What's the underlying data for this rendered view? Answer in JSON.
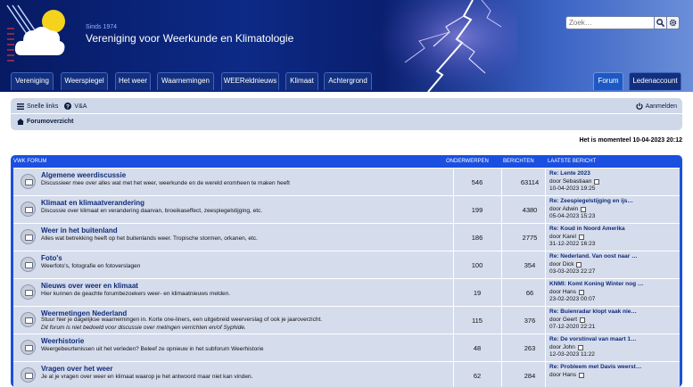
{
  "header": {
    "since": "Sinds 1974",
    "title": "Vereniging voor Weerkunde en Klimatologie",
    "search_placeholder": "Zoek…"
  },
  "tabs": [
    {
      "label": "Vereniging"
    },
    {
      "label": "Weerspiegel"
    },
    {
      "label": "Het weer"
    },
    {
      "label": "Waarnemingen"
    },
    {
      "label": "WEEReldnieuws"
    },
    {
      "label": "Klimaat"
    },
    {
      "label": "Achtergrond"
    },
    {
      "label": "Forum"
    },
    {
      "label": "Ledenaccount"
    }
  ],
  "nav": {
    "quick_links": "Snelle links",
    "faq": "V&A",
    "login": "Aanmelden",
    "forum_index": "Forumoverzicht"
  },
  "current_time": "Het is momenteel 10-04-2023 20:12",
  "forum": {
    "section_title": "VWK FORUM",
    "col_topics": "ONDERWERPEN",
    "col_posts": "BERICHTEN",
    "col_last": "LAATSTE BERICHT",
    "rows": [
      {
        "title": "Algemene weerdiscussie",
        "desc": "Discussieer mee over alles wat met het weer, weerkunde en de wereld eromheen te maken heeft",
        "desc2": "",
        "topics": "546",
        "posts": "63114",
        "last_title": "Re: Lente 2023",
        "last_by": "door Sebastiaan",
        "last_date": "10-04-2023 19:25"
      },
      {
        "title": "Klimaat en klimaatverandering",
        "desc": "Discussie over klimaat en verandering daarvan, broeikaseffect, zeespiegelstijging, etc.",
        "desc2": "",
        "topics": "199",
        "posts": "4380",
        "last_title": "Re: Zeespiegelstijging en ijs…",
        "last_by": "door Adwin",
        "last_date": "05-04-2023 15:23"
      },
      {
        "title": "Weer in het buitenland",
        "desc": "Alles wat betrekking heeft op het buitenlands weer. Tropische stormen, orkanen, etc.",
        "desc2": "",
        "topics": "186",
        "posts": "2775",
        "last_title": "Re: Koud in Noord Amerika",
        "last_by": "door Karel",
        "last_date": "31-12-2022 16:23"
      },
      {
        "title": "Foto's",
        "desc": "Weerfoto's, fotografie en fotoverslagen",
        "desc2": "",
        "topics": "100",
        "posts": "354",
        "last_title": "Re: Nederland. Van oost naar …",
        "last_by": "door Dick",
        "last_date": "03-03-2023 22:27"
      },
      {
        "title": "Nieuws over weer en klimaat",
        "desc": "Hier kunnen de geachte forumbezoekers weer- en klimaatnieuws melden.",
        "desc2": "",
        "topics": "19",
        "posts": "66",
        "last_title": "KNMI: Komt Koning Winter nog …",
        "last_by": "door Hans",
        "last_date": "23-02-2023 00:07"
      },
      {
        "title": "Weermetingen Nederland",
        "desc": "Stuur hier je dagelijkse waarnemingen in. Korte one-liners, een uitgebreid weerverslag of ook je jaaroverzicht.",
        "desc2": "Dit forum is niet bedoeld voor discussie over metingen verrichten en/of Syphide.",
        "topics": "115",
        "posts": "376",
        "last_title": "Re: Buienradar klopt vaak nie…",
        "last_by": "door Geert",
        "last_date": "07-12-2020 22:21"
      },
      {
        "title": "Weerhistorie",
        "desc": "Weergebeurtenissen uit het verleden? Beleef ze opnieuw in het subforum Weerhistorie",
        "desc2": "",
        "topics": "48",
        "posts": "263",
        "last_title": "Re: De vorstinval van maart 1…",
        "last_by": "door John",
        "last_date": "12-03-2023 11:22"
      },
      {
        "title": "Vragen over het weer",
        "desc": "Je al je vragen over weer en klimaat waarop je het antwoord maar niet kan vinden.",
        "desc2": "",
        "topics": "62",
        "posts": "284",
        "last_title": "Re: Probleem met Davis weerst…",
        "last_by": "door Hans",
        "last_date": ""
      }
    ]
  }
}
